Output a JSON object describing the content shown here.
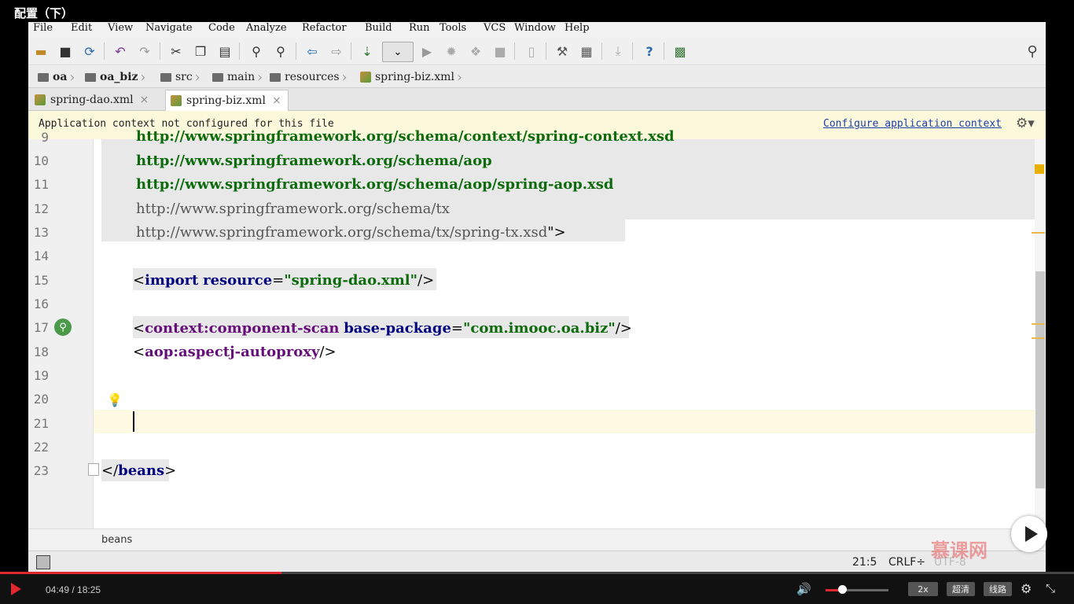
{
  "video": {
    "title": "配置（下）"
  },
  "menu": [
    "File",
    "Edit",
    "View",
    "Navigate",
    "Code",
    "Analyze",
    "Refactor",
    "Build",
    "Run",
    "Tools",
    "VCS",
    "Window",
    "Help"
  ],
  "breadcrumb": [
    "oa",
    "oa_biz",
    "src",
    "main",
    "resources",
    "spring-biz.xml"
  ],
  "tabs": [
    {
      "label": "spring-dao.xml",
      "active": false
    },
    {
      "label": "spring-biz.xml",
      "active": true
    }
  ],
  "banner": {
    "message": "Application context not configured for this file",
    "link": "Configure application context"
  },
  "editor": {
    "line_numbers": [
      "9",
      "10",
      "11",
      "12",
      "13",
      "14",
      "15",
      "16",
      "17",
      "18",
      "19",
      "20",
      "21",
      "22",
      "23"
    ],
    "lines": {
      "l9": "http://www.springframework.org/schema/context/spring-context.xsd",
      "l10": "http://www.springframework.org/schema/aop",
      "l11": "http://www.springframework.org/schema/aop/spring-aop.xsd",
      "l12": "http://www.springframework.org/schema/tx",
      "l13a": "http://www.springframework.org/schema/tx/spring-tx.xsd",
      "l13b": "\">",
      "l15_open": "<",
      "l15_tag": "import",
      "l15_attr": "resource",
      "l15_eq": "=",
      "l15_val": "\"spring-dao.xml\"",
      "l15_close": "/>",
      "l17_open": "<",
      "l17_tag": "context:component-scan",
      "l17_attr": "base-package",
      "l17_eq": "=",
      "l17_val": "\"com.imooc.oa.biz\"",
      "l17_close": "/>",
      "l18_open": "<",
      "l18_tag": "aop:aspectj-autoproxy",
      "l18_close": "/>",
      "l23_open": "</",
      "l23_tag": "beans",
      "l23_close": ">"
    }
  },
  "structure_crumb": "beans",
  "status": {
    "position": "21:5",
    "line_sep": "CRLF÷",
    "encoding": "UTF-8"
  },
  "player": {
    "time": "04:49 / 18:25",
    "progress": 0.262,
    "volume": 0.25,
    "speed": "2x",
    "quality": "超清",
    "route": "线路"
  },
  "watermark": "慕课网",
  "colors": {
    "accent_red": "#e0262e",
    "banner_bg": "#fbf8dc",
    "link": "#1d3fa8"
  }
}
